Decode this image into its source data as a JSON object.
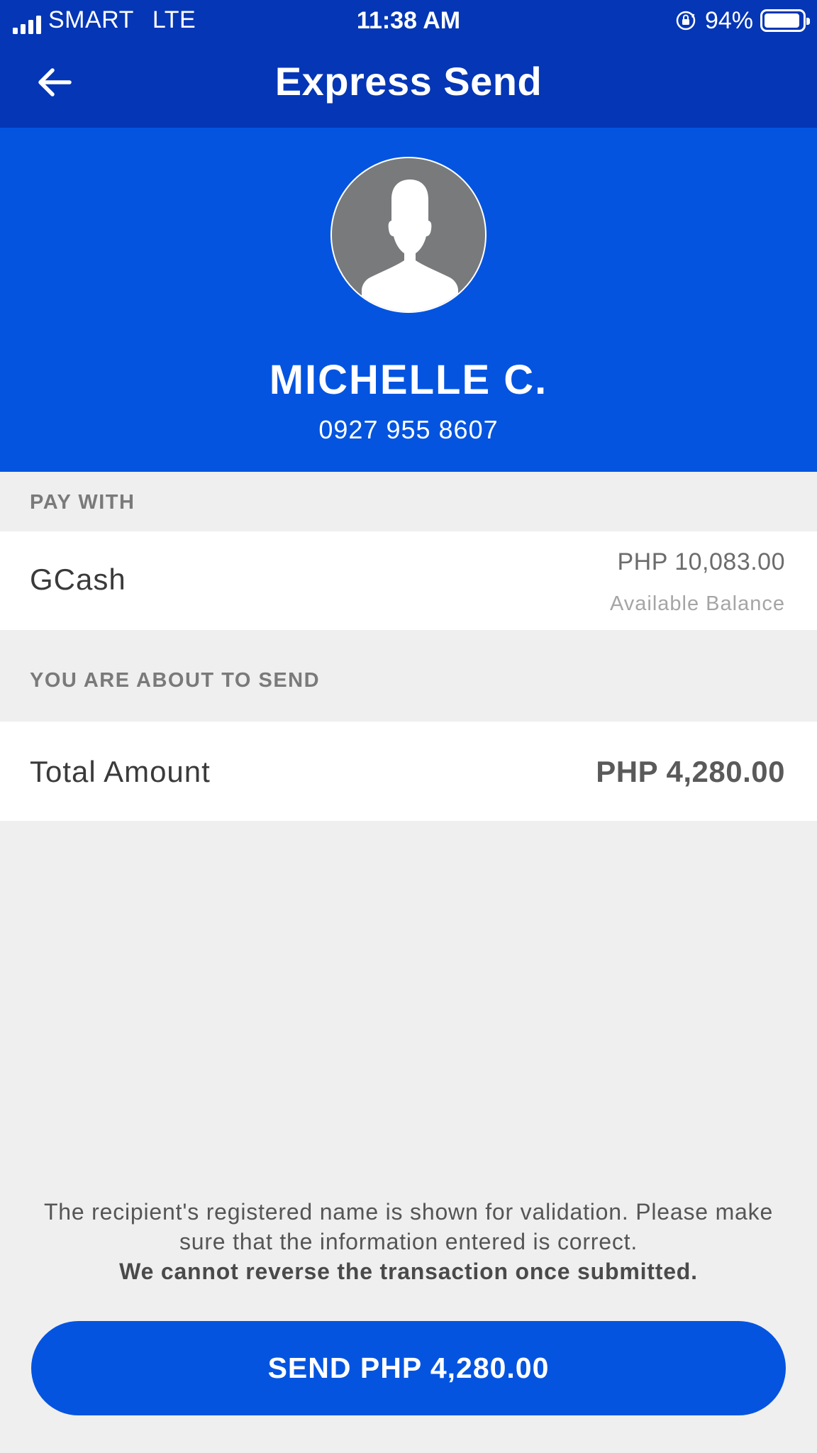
{
  "status_bar": {
    "carrier": "SMART",
    "network": "LTE",
    "time": "11:38 AM",
    "battery": "94%",
    "battery_level": 0.94
  },
  "header": {
    "title": "Express Send",
    "back_icon": "arrow-left-icon"
  },
  "recipient": {
    "avatar_icon": "person-silhouette-icon",
    "name": "MICHELLE C.",
    "phone": "0927 955 8607"
  },
  "pay_with": {
    "section_label": "PAY WITH",
    "method": "GCash",
    "balance_amount": "PHP 10,083.00",
    "balance_label": "Available Balance"
  },
  "send_summary": {
    "section_label": "YOU ARE ABOUT TO SEND",
    "total_label": "Total Amount",
    "total_amount": "PHP 4,280.00"
  },
  "disclaimer": {
    "text": "The recipient's registered name is shown for validation. Please make sure that the information entered is correct.",
    "warning": "We cannot reverse the transaction once submitted."
  },
  "actions": {
    "send_label": "SEND PHP 4,280.00"
  },
  "colors": {
    "header_blue": "#0436b5",
    "brand_blue": "#0454e0",
    "background": "#efefef"
  }
}
